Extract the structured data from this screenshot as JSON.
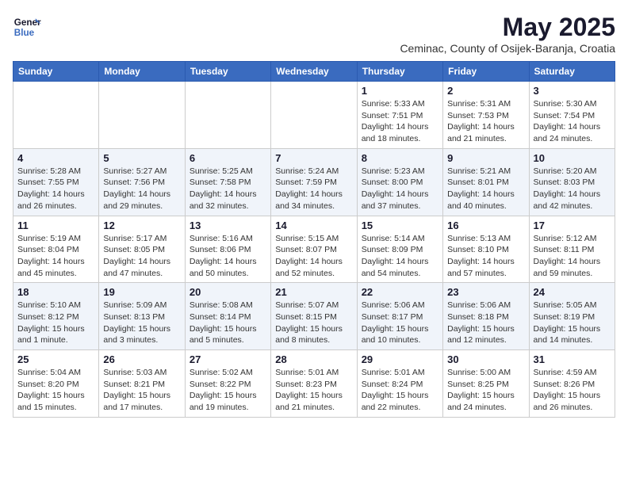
{
  "header": {
    "logo_line1": "General",
    "logo_line2": "Blue",
    "month_year": "May 2025",
    "location": "Ceminac, County of Osijek-Baranja, Croatia"
  },
  "weekdays": [
    "Sunday",
    "Monday",
    "Tuesday",
    "Wednesday",
    "Thursday",
    "Friday",
    "Saturday"
  ],
  "weeks": [
    [
      {
        "day": "",
        "info": ""
      },
      {
        "day": "",
        "info": ""
      },
      {
        "day": "",
        "info": ""
      },
      {
        "day": "",
        "info": ""
      },
      {
        "day": "1",
        "info": "Sunrise: 5:33 AM\nSunset: 7:51 PM\nDaylight: 14 hours\nand 18 minutes."
      },
      {
        "day": "2",
        "info": "Sunrise: 5:31 AM\nSunset: 7:53 PM\nDaylight: 14 hours\nand 21 minutes."
      },
      {
        "day": "3",
        "info": "Sunrise: 5:30 AM\nSunset: 7:54 PM\nDaylight: 14 hours\nand 24 minutes."
      }
    ],
    [
      {
        "day": "4",
        "info": "Sunrise: 5:28 AM\nSunset: 7:55 PM\nDaylight: 14 hours\nand 26 minutes."
      },
      {
        "day": "5",
        "info": "Sunrise: 5:27 AM\nSunset: 7:56 PM\nDaylight: 14 hours\nand 29 minutes."
      },
      {
        "day": "6",
        "info": "Sunrise: 5:25 AM\nSunset: 7:58 PM\nDaylight: 14 hours\nand 32 minutes."
      },
      {
        "day": "7",
        "info": "Sunrise: 5:24 AM\nSunset: 7:59 PM\nDaylight: 14 hours\nand 34 minutes."
      },
      {
        "day": "8",
        "info": "Sunrise: 5:23 AM\nSunset: 8:00 PM\nDaylight: 14 hours\nand 37 minutes."
      },
      {
        "day": "9",
        "info": "Sunrise: 5:21 AM\nSunset: 8:01 PM\nDaylight: 14 hours\nand 40 minutes."
      },
      {
        "day": "10",
        "info": "Sunrise: 5:20 AM\nSunset: 8:03 PM\nDaylight: 14 hours\nand 42 minutes."
      }
    ],
    [
      {
        "day": "11",
        "info": "Sunrise: 5:19 AM\nSunset: 8:04 PM\nDaylight: 14 hours\nand 45 minutes."
      },
      {
        "day": "12",
        "info": "Sunrise: 5:17 AM\nSunset: 8:05 PM\nDaylight: 14 hours\nand 47 minutes."
      },
      {
        "day": "13",
        "info": "Sunrise: 5:16 AM\nSunset: 8:06 PM\nDaylight: 14 hours\nand 50 minutes."
      },
      {
        "day": "14",
        "info": "Sunrise: 5:15 AM\nSunset: 8:07 PM\nDaylight: 14 hours\nand 52 minutes."
      },
      {
        "day": "15",
        "info": "Sunrise: 5:14 AM\nSunset: 8:09 PM\nDaylight: 14 hours\nand 54 minutes."
      },
      {
        "day": "16",
        "info": "Sunrise: 5:13 AM\nSunset: 8:10 PM\nDaylight: 14 hours\nand 57 minutes."
      },
      {
        "day": "17",
        "info": "Sunrise: 5:12 AM\nSunset: 8:11 PM\nDaylight: 14 hours\nand 59 minutes."
      }
    ],
    [
      {
        "day": "18",
        "info": "Sunrise: 5:10 AM\nSunset: 8:12 PM\nDaylight: 15 hours\nand 1 minute."
      },
      {
        "day": "19",
        "info": "Sunrise: 5:09 AM\nSunset: 8:13 PM\nDaylight: 15 hours\nand 3 minutes."
      },
      {
        "day": "20",
        "info": "Sunrise: 5:08 AM\nSunset: 8:14 PM\nDaylight: 15 hours\nand 5 minutes."
      },
      {
        "day": "21",
        "info": "Sunrise: 5:07 AM\nSunset: 8:15 PM\nDaylight: 15 hours\nand 8 minutes."
      },
      {
        "day": "22",
        "info": "Sunrise: 5:06 AM\nSunset: 8:17 PM\nDaylight: 15 hours\nand 10 minutes."
      },
      {
        "day": "23",
        "info": "Sunrise: 5:06 AM\nSunset: 8:18 PM\nDaylight: 15 hours\nand 12 minutes."
      },
      {
        "day": "24",
        "info": "Sunrise: 5:05 AM\nSunset: 8:19 PM\nDaylight: 15 hours\nand 14 minutes."
      }
    ],
    [
      {
        "day": "25",
        "info": "Sunrise: 5:04 AM\nSunset: 8:20 PM\nDaylight: 15 hours\nand 15 minutes."
      },
      {
        "day": "26",
        "info": "Sunrise: 5:03 AM\nSunset: 8:21 PM\nDaylight: 15 hours\nand 17 minutes."
      },
      {
        "day": "27",
        "info": "Sunrise: 5:02 AM\nSunset: 8:22 PM\nDaylight: 15 hours\nand 19 minutes."
      },
      {
        "day": "28",
        "info": "Sunrise: 5:01 AM\nSunset: 8:23 PM\nDaylight: 15 hours\nand 21 minutes."
      },
      {
        "day": "29",
        "info": "Sunrise: 5:01 AM\nSunset: 8:24 PM\nDaylight: 15 hours\nand 22 minutes."
      },
      {
        "day": "30",
        "info": "Sunrise: 5:00 AM\nSunset: 8:25 PM\nDaylight: 15 hours\nand 24 minutes."
      },
      {
        "day": "31",
        "info": "Sunrise: 4:59 AM\nSunset: 8:26 PM\nDaylight: 15 hours\nand 26 minutes."
      }
    ]
  ]
}
